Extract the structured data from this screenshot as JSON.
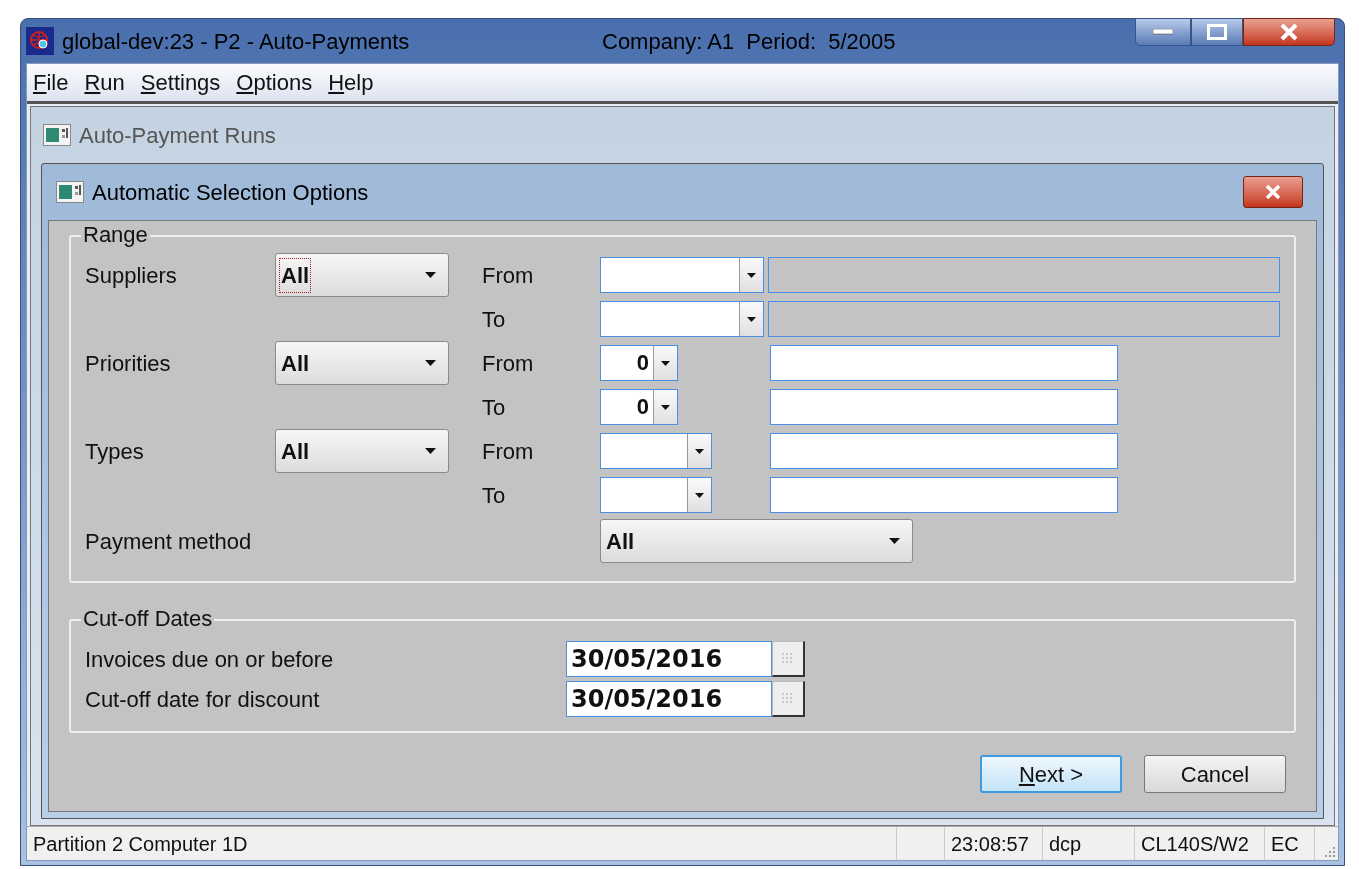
{
  "window": {
    "title": "global-dev:23 - P2 - Auto-Payments",
    "context": "Company: A1  Period:  5/2005"
  },
  "menu": [
    {
      "accel": "F",
      "rest": "ile"
    },
    {
      "accel": "R",
      "rest": "un"
    },
    {
      "accel": "S",
      "rest": "ettings"
    },
    {
      "accel": "O",
      "rest": "ptions"
    },
    {
      "accel": "H",
      "rest": "elp"
    }
  ],
  "parent_panel": {
    "title": "Auto-Payment Runs"
  },
  "dialog": {
    "title": "Automatic Selection Options"
  },
  "range": {
    "title": "Range",
    "filters": [
      {
        "kind": "supplier",
        "label": "Suppliers",
        "selector": "All",
        "focused": true,
        "from_label": "From",
        "to_label": "To"
      },
      {
        "kind": "priority",
        "label": "Priorities",
        "selector": "All",
        "focused": false,
        "from_label": "From",
        "to_label": "To",
        "from_value": "0",
        "to_value": "0"
      },
      {
        "kind": "type",
        "label": "Types",
        "selector": "All",
        "focused": false,
        "from_label": "From",
        "to_label": "To"
      }
    ],
    "payment_method": {
      "label": "Payment method",
      "value": "All"
    }
  },
  "cutoff": {
    "title": "Cut-off Dates",
    "dates": [
      {
        "label": "Invoices due on or before",
        "value": "30/05/2016"
      },
      {
        "label": "Cut-off date for discount",
        "value": "30/05/2016"
      }
    ]
  },
  "buttons": [
    {
      "accel": "N",
      "rest": "ext >",
      "default": true
    },
    {
      "label": "Cancel",
      "default": false
    }
  ],
  "status_bar": [
    "Partition 2 Computer 1D",
    "23:08:57",
    "dcp",
    "CL140S/W2",
    "EC"
  ]
}
